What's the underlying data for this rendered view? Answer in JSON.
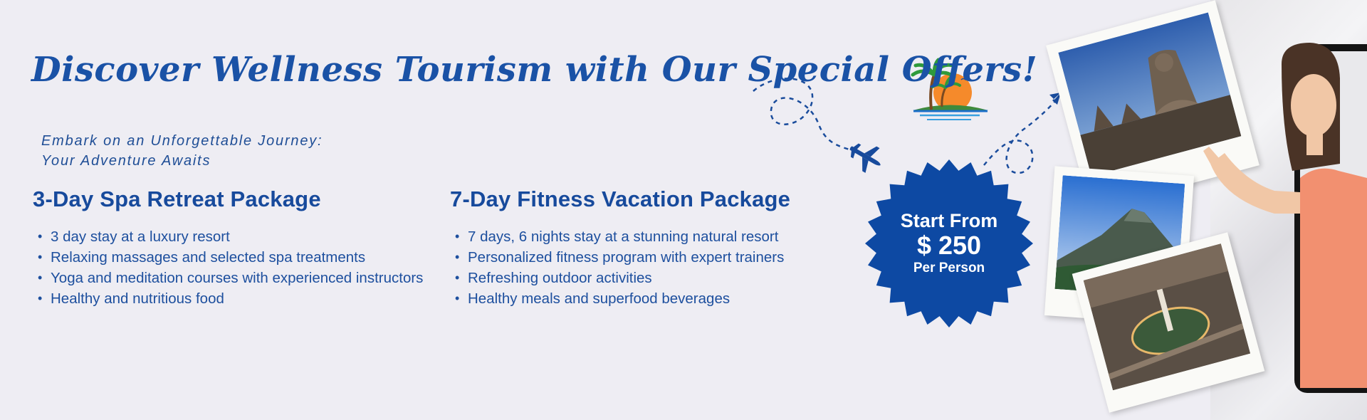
{
  "headline": "Discover Wellness Tourism with Our Special Offers!",
  "tagline": {
    "line1": "Embark on an Unforgettable Journey:",
    "line2": "Your Adventure Awaits"
  },
  "packages": [
    {
      "title": "3-Day Spa Retreat Package",
      "items": [
        "3 day stay at a luxury resort",
        "Relaxing massages and selected spa treatments",
        "Yoga and meditation courses with experienced instructors",
        "Healthy and nutritious food"
      ]
    },
    {
      "title": "7-Day Fitness Vacation Package",
      "items": [
        "7 days, 6 nights stay at a stunning natural resort",
        "Personalized fitness program with expert trainers",
        "Refreshing outdoor activities",
        "Healthy meals and superfood beverages"
      ]
    }
  ],
  "price_badge": {
    "line1": "Start From",
    "line2": "$ 250",
    "line3": "Per Person"
  },
  "icons": {
    "island": "tropical-island-sunset-icon",
    "airplane": "airplane-icon",
    "arrow": "arrow-icon"
  },
  "colors": {
    "background": "#eeedf3",
    "brand_blue": "#174a9c",
    "badge_blue": "#0d49a3",
    "accent_orange": "#f58a2b",
    "accent_green": "#2f9a3c"
  }
}
